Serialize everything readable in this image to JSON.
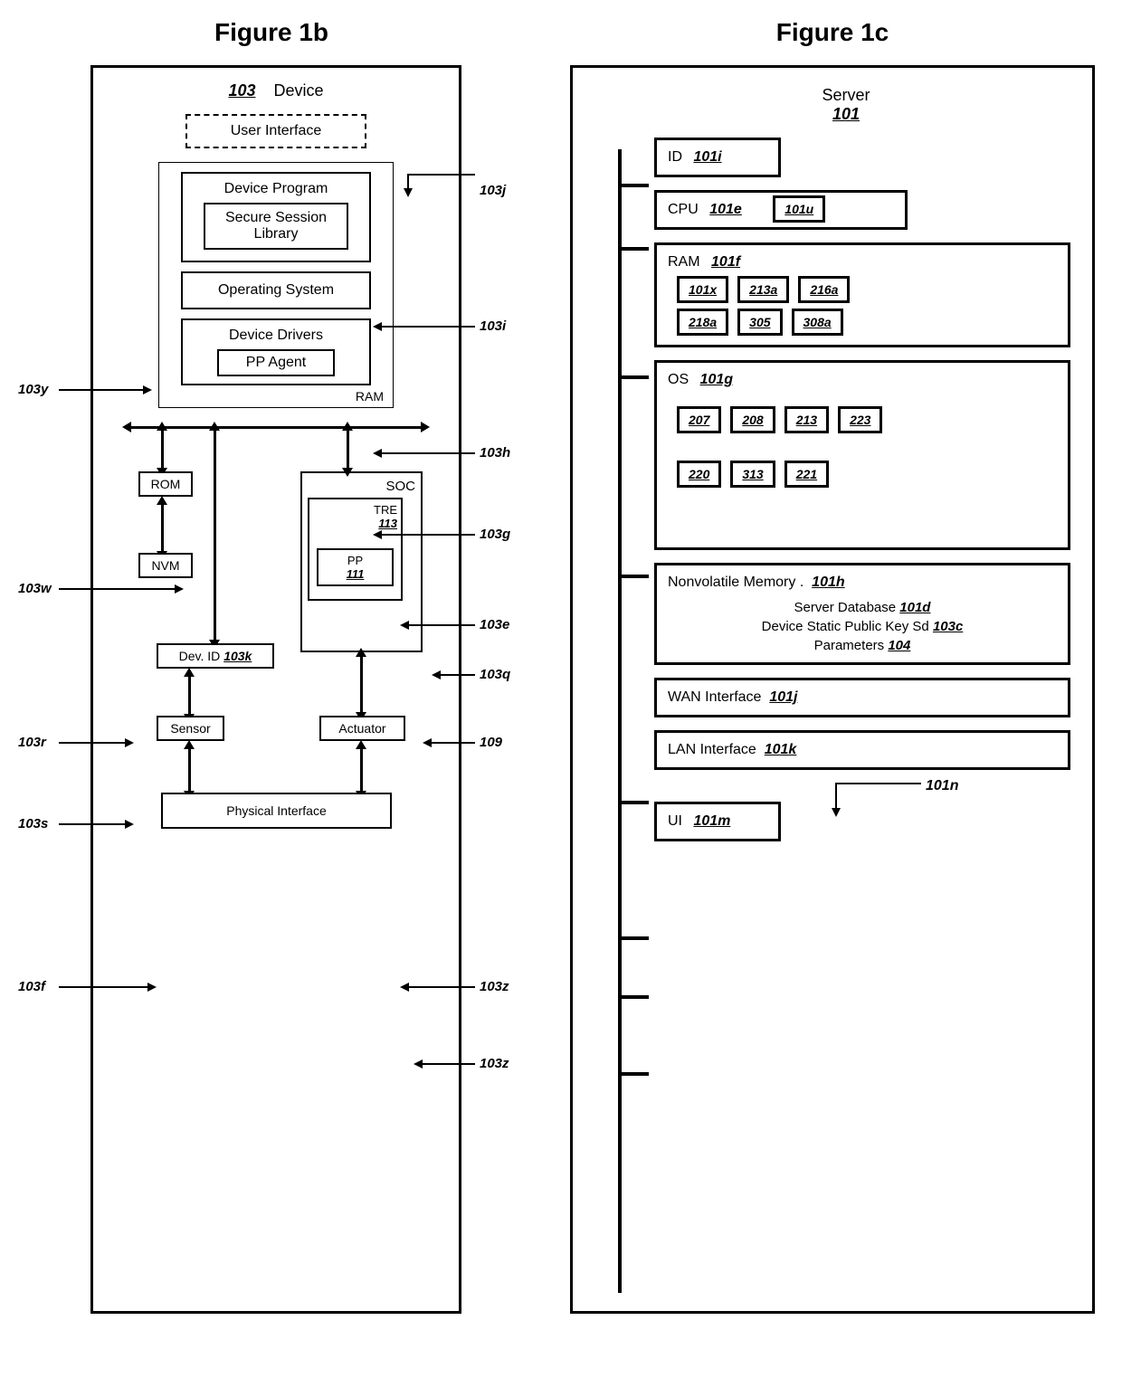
{
  "fig1b": {
    "title": "Figure 1b",
    "device_label": "Device",
    "device_id": "103",
    "user_interface": "User Interface",
    "device_program": "Device Program",
    "secure_session_library": "Secure Session\nLibrary",
    "operating_system": "Operating System",
    "device_drivers": "Device Drivers",
    "pp_agent": "PP Agent",
    "ram_label": "RAM",
    "rom": "ROM",
    "nvm": "NVM",
    "dev_id_label": "Dev. ID",
    "dev_id_ref": "103k",
    "sensor": "Sensor",
    "soc": "SOC",
    "tre": "TRE",
    "tre_ref": "113",
    "pp": "PP",
    "pp_ref": "111",
    "actuator": "Actuator",
    "physical_interface": "Physical Interface",
    "callouts": {
      "c103j": "103j",
      "c103i": "103i",
      "c103h": "103h",
      "c103g": "103g",
      "c103e": "103e",
      "c103q": "103q",
      "c109": "109",
      "c103y": "103y",
      "c103w": "103w",
      "c103r": "103r",
      "c103s": "103s",
      "c103f": "103f",
      "c103z1": "103z",
      "c103z2": "103z"
    }
  },
  "fig1c": {
    "title": "Figure 1c",
    "server_label": "Server",
    "server_id": "101",
    "id_label": "ID",
    "id_ref": "101i",
    "cpu_label": "CPU",
    "cpu_ref": "101e",
    "cpu_items": [
      "101u"
    ],
    "ram_label": "RAM",
    "ram_ref": "101f",
    "ram_row1": [
      "101x",
      "213a",
      "216a"
    ],
    "ram_row2": [
      "218a",
      "305",
      "308a"
    ],
    "os_label": "OS",
    "os_ref": "101g",
    "os_row1": [
      "207",
      "208",
      "213",
      "223"
    ],
    "os_row2": [
      "220",
      "313",
      "221"
    ],
    "nv_label": "Nonvolatile Memory .",
    "nv_ref": "101h",
    "nv_line1_a": "Server Database",
    "nv_line1_b": "101d",
    "nv_line2_a": "Device Static Public Key Sd",
    "nv_line2_b": "103c",
    "nv_line3_a": "Parameters",
    "nv_line3_b": "104",
    "wan_label": "WAN Interface",
    "wan_ref": "101j",
    "lan_label": "LAN Interface",
    "lan_ref": "101k",
    "ui_label": "UI",
    "ui_ref": "101m",
    "ui_arrow_ref": "101n"
  }
}
